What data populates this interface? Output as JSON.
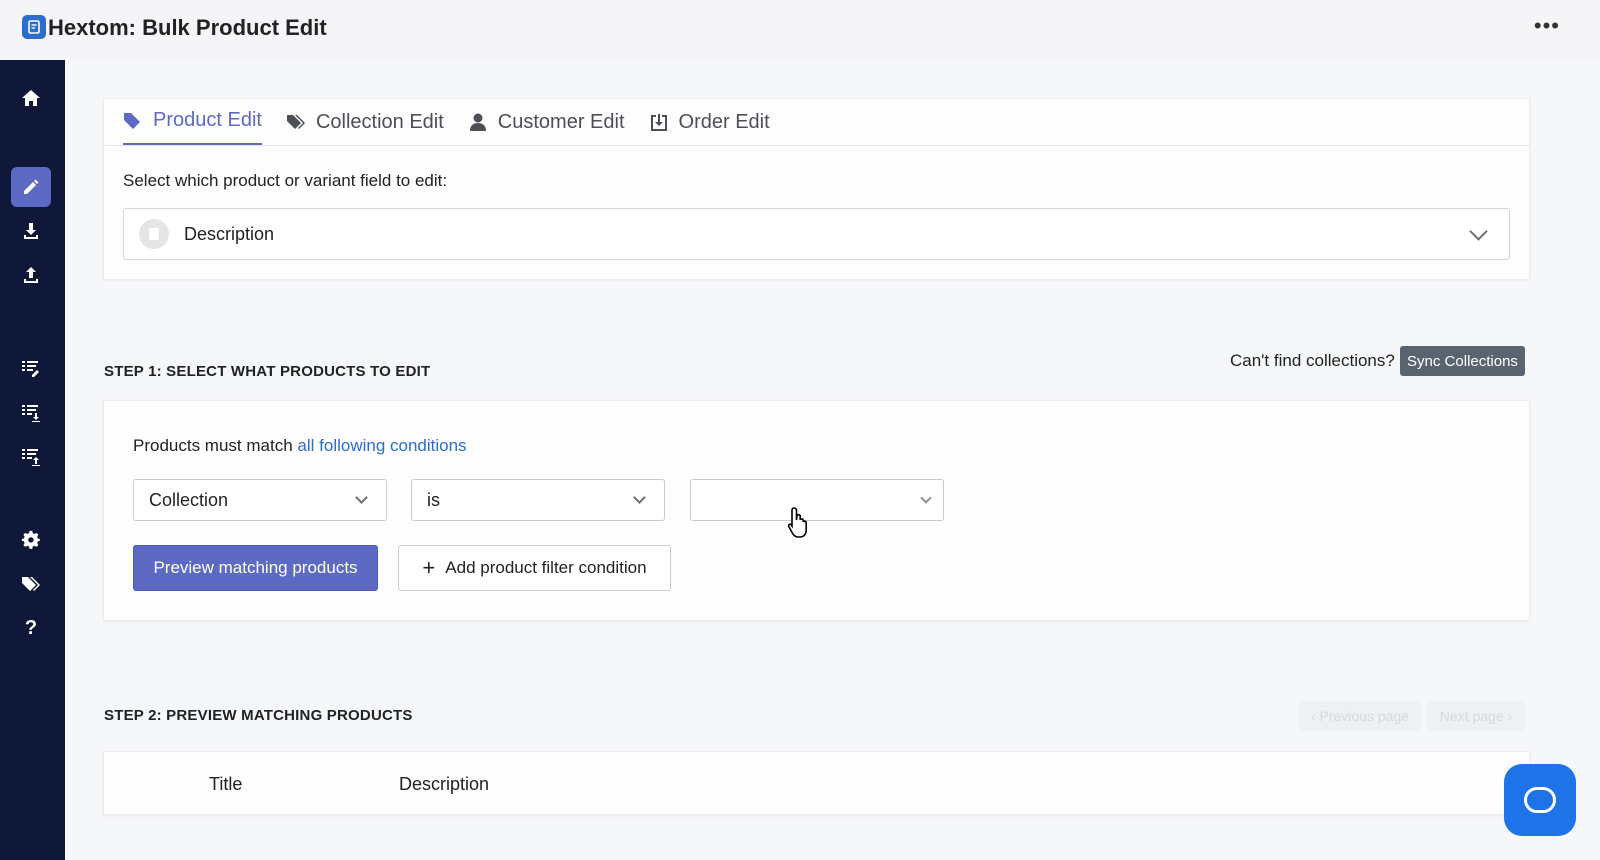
{
  "app": {
    "title": "Hextom: Bulk Product Edit",
    "more_icon": "more-horizontal-icon"
  },
  "sidebar": {
    "items": [
      {
        "icon": "home-icon"
      },
      {
        "icon": "pencil-icon",
        "active": true
      },
      {
        "icon": "download-icon"
      },
      {
        "icon": "upload-icon"
      },
      {
        "icon": "list-edit-icon"
      },
      {
        "icon": "list-download-icon"
      },
      {
        "icon": "list-upload-icon"
      },
      {
        "icon": "gear-icon"
      },
      {
        "icon": "tags-icon"
      },
      {
        "icon": "help-icon",
        "label": "?"
      }
    ]
  },
  "tabs": [
    {
      "label": "Product Edit",
      "icon": "tag-icon",
      "active": true
    },
    {
      "label": "Collection Edit",
      "icon": "tags-icon"
    },
    {
      "label": "Customer Edit",
      "icon": "user-icon"
    },
    {
      "label": "Order Edit",
      "icon": "order-download-icon"
    }
  ],
  "field": {
    "label": "Select which product or variant field to edit:",
    "value": "Description"
  },
  "step1": {
    "title": "STEP 1: SELECT WHAT PRODUCTS TO EDIT",
    "cant_find": "Can't find collections?",
    "sync_label": "Sync Collections",
    "match_prefix": "Products must match",
    "match_link": "all following conditions",
    "condition": {
      "field": "Collection",
      "operator": "is",
      "value": ""
    },
    "preview_label": "Preview matching products",
    "add_condition_label": "Add product filter condition"
  },
  "step2": {
    "title": "STEP 2: PREVIEW MATCHING PRODUCTS",
    "prev_label": "Previous page",
    "next_label": "Next page",
    "columns": [
      "Title",
      "Description"
    ]
  },
  "colors": {
    "accent": "#5c6ac4",
    "sidebar": "#0f1838",
    "link": "#2c6ecb",
    "chat": "#1f73e8"
  }
}
